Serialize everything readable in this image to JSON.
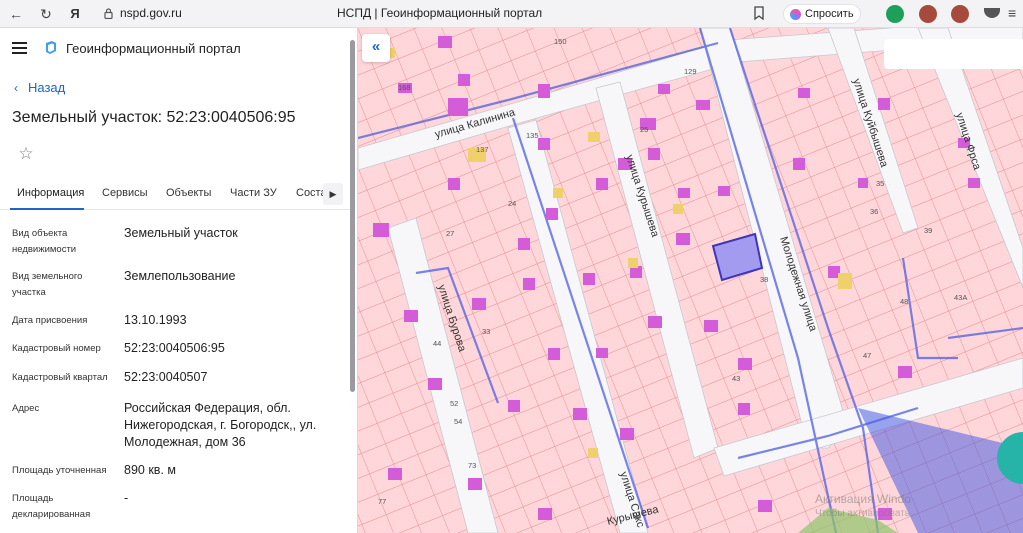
{
  "browser": {
    "url": "nspd.gov.ru",
    "tab_title": "НСПД | Геоинформационный портал",
    "ask_label": "Спросить"
  },
  "header": {
    "portal_name": "Геоинформационный портал"
  },
  "panel": {
    "back_label": "Назад",
    "title": "Земельный участок: 52:23:0040506:95",
    "tabs": [
      "Информация",
      "Сервисы",
      "Объекты",
      "Части ЗУ",
      "Соста"
    ],
    "fields": [
      {
        "label": "Вид объекта недвижимости",
        "value": "Земельный участок"
      },
      {
        "label": "Вид земельного участка",
        "value": "Землепользование"
      },
      {
        "label": "Дата присвоения",
        "value": "13.10.1993"
      },
      {
        "label": "Кадастровый номер",
        "value": "52:23:0040506:95"
      },
      {
        "label": "Кадастровый квартал",
        "value": "52:23:0040507"
      },
      {
        "label": "Адрес",
        "value": "Российская Федерация, обл. Нижегородская, г. Богородск,, ул. Молодежная, дом 36"
      },
      {
        "label": "Площадь уточненная",
        "value": "890 кв. м"
      },
      {
        "label": "Площадь декларированная",
        "value": "-"
      }
    ]
  },
  "map": {
    "streets": [
      "улица Калинина",
      "улица Курышева",
      "Молодежная улица",
      "улица Бурова",
      "улица Куйбышева",
      "улица Фрса",
      "улица Сакс",
      "Курышева"
    ],
    "plot_numbers": [
      "150",
      "168",
      "135",
      "137",
      "25",
      "27",
      "129",
      "35",
      "36",
      "38",
      "39",
      "43",
      "43А",
      "44",
      "47",
      "48",
      "52",
      "54",
      "73",
      "77",
      "24",
      "33"
    ],
    "watermark": "Активация Windo",
    "watermark_sub": "Чтобы активировать"
  },
  "colors": {
    "accent": "#1b66c9",
    "map_background": "#ffd9dc",
    "parcel_border": "#e27b7b",
    "building": "#d55cd8",
    "selected_parcel": "#7a6fe0",
    "road": "#f7f7f9",
    "boundary": "#4d5ee0"
  }
}
